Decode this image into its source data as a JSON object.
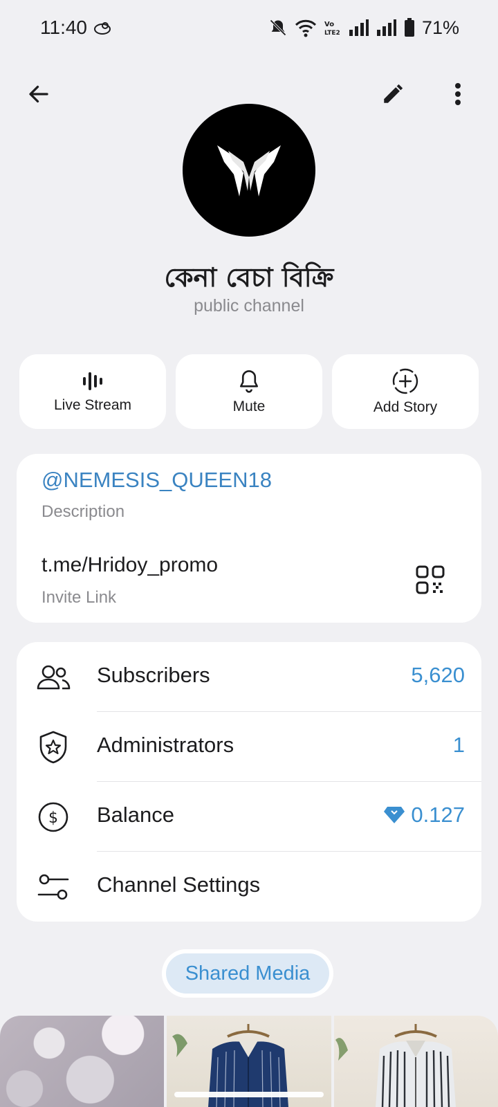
{
  "status_bar": {
    "time": "11:40",
    "battery": "71%",
    "lte_label": "Vo LTE2"
  },
  "header": {
    "back_icon": "arrow-left-icon",
    "edit_icon": "pencil-icon",
    "more_icon": "more-vertical-icon"
  },
  "channel": {
    "name": "কেনা বেচা বিক্রি",
    "type": "public channel"
  },
  "actions": [
    {
      "label": "Live Stream",
      "icon": "live-stream-icon"
    },
    {
      "label": "Mute",
      "icon": "bell-icon"
    },
    {
      "label": "Add Story",
      "icon": "add-story-icon"
    }
  ],
  "info": {
    "username": "@NEMESIS_QUEEN18",
    "username_caption": "Description",
    "invite_link": "t.me/Hridoy_promo",
    "invite_caption": "Invite Link"
  },
  "stats": [
    {
      "label": "Subscribers",
      "value": "5,620",
      "icon": "users-icon"
    },
    {
      "label": "Administrators",
      "value": "1",
      "icon": "shield-star-icon"
    },
    {
      "label": "Balance",
      "value": "0.127",
      "icon": "dollar-circle-icon"
    },
    {
      "label": "Channel Settings",
      "value": "",
      "icon": "sliders-icon"
    }
  ],
  "shared_media": {
    "label": "Shared Media"
  },
  "colors": {
    "accent": "#3a8fd0",
    "link": "#3a83c1",
    "background": "#f0f0f3"
  }
}
